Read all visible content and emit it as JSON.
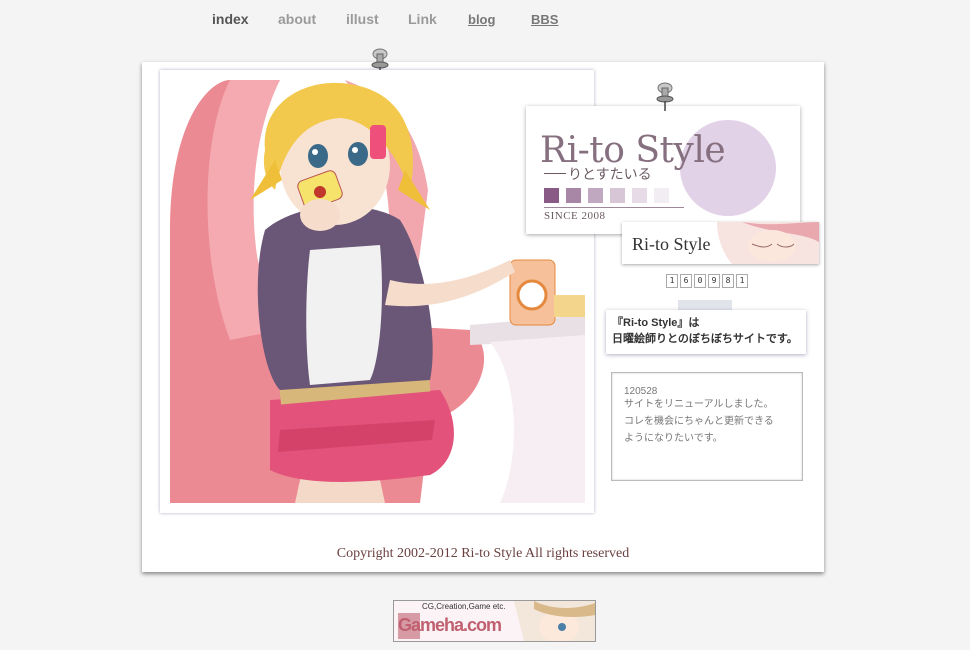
{
  "nav": {
    "items": [
      {
        "label": "index"
      },
      {
        "label": "about"
      },
      {
        "label": "illust"
      },
      {
        "label": "Link"
      },
      {
        "label": "blog"
      },
      {
        "label": "BBS"
      }
    ]
  },
  "logo": {
    "title": "Ri-to Style",
    "subtitle": "りとすたいる",
    "since": "SINCE 2008",
    "swatches": [
      "#8a5a86",
      "#a887a6",
      "#c0a9c0",
      "#d6c6d6",
      "#e6dbe6",
      "#f2edf2"
    ]
  },
  "banner": {
    "text": "Ri-to Style"
  },
  "counter": {
    "digits": [
      "1",
      "6",
      "0",
      "9",
      "8",
      "1"
    ]
  },
  "note": {
    "line1": "『Ri-to Style』は",
    "line2": "日曜絵師りとのぼちぼちサイトです。"
  },
  "news": {
    "date": "120528",
    "line1": "サイトをリニューアルしました。",
    "line2": "コレを機会にちゃんと更新できる",
    "line3": "ようになりたいです。"
  },
  "footer": {
    "copyright": "Copyright 2002-2012 Ri-to Style All rights reserved"
  },
  "gamebanner": {
    "tagline": "CG,Creation,Game etc.",
    "logo": "Gameha.com"
  },
  "colors": {
    "background": "#f4f4f4",
    "nav_active": "#555555",
    "nav_inactive": "#9a9a9a",
    "copyright": "#6a3f3f"
  }
}
